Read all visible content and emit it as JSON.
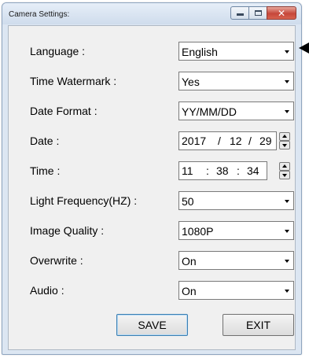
{
  "window": {
    "title": "Camera Settings:"
  },
  "settings": {
    "language": {
      "label": "Language :",
      "value": "English"
    },
    "time_watermark": {
      "label": "Time Watermark :",
      "value": "Yes"
    },
    "date_format": {
      "label": "Date Format :",
      "value": "YY/MM/DD"
    },
    "date": {
      "label": "Date :",
      "year": "2017",
      "month": "12",
      "day": "29",
      "sep": "/"
    },
    "time": {
      "label": "Time :",
      "hour": "11",
      "minute": "38",
      "second": "34",
      "sep": ":"
    },
    "light_frequency": {
      "label": "Light Frequency(HZ) :",
      "value": "50"
    },
    "image_quality": {
      "label": "Image Quality :",
      "value": "1080P"
    },
    "overwrite": {
      "label": "Overwrite :",
      "value": "On"
    },
    "audio": {
      "label": "Audio :",
      "value": "On"
    }
  },
  "buttons": {
    "save": "SAVE",
    "exit": "EXIT"
  },
  "icons": {
    "minimize": "minimize-icon",
    "maximize": "maximize-icon",
    "close": "close-icon",
    "dropdown": "chevron-down-icon",
    "pointer": "arrow-left-icon"
  },
  "colors": {
    "window_frame": "#dce6f2",
    "client_bg": "#f0f0f0",
    "close_button": "#c6473a"
  }
}
